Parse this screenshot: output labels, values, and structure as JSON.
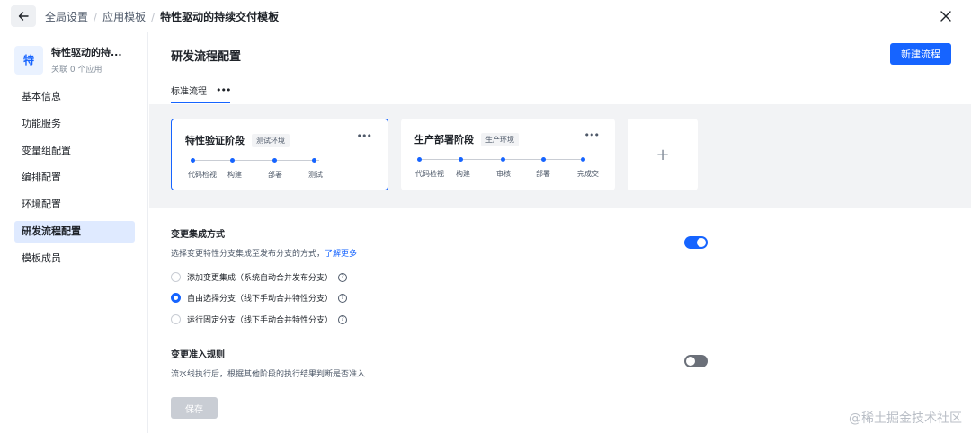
{
  "breadcrumb": [
    "全局设置",
    "应用模板"
  ],
  "breadcrumb_current": "特性驱动的持续交付模板",
  "template": {
    "avatar": "特",
    "name": "特性驱动的持...",
    "sub": "关联 0 个应用"
  },
  "nav": {
    "items": [
      "基本信息",
      "功能服务",
      "变量组配置",
      "编排配置",
      "环境配置",
      "研发流程配置",
      "模板成员"
    ],
    "active": "研发流程配置"
  },
  "main": {
    "title": "研发流程配置",
    "new_button": "新建流程",
    "tab": "标准流程",
    "more": "•••"
  },
  "stages": [
    {
      "name": "特性验证阶段",
      "env": "测试环境",
      "steps": [
        "代码检视",
        "构建",
        "部署",
        "测试"
      ]
    },
    {
      "name": "生产部署阶段",
      "env": "生产环境",
      "steps": [
        "代码检视",
        "构建",
        "审核",
        "部署",
        "完成交"
      ]
    }
  ],
  "add_stage": "+",
  "change_integration": {
    "title": "变更集成方式",
    "desc": "选择变更特性分支集成至发布分支的方式，",
    "link": "了解更多",
    "enabled": true,
    "options": [
      "添加变更集成（系统自动合并发布分支）",
      "自由选择分支（线下手动合并特性分支）",
      "运行固定分支（线下手动合并特性分支）"
    ],
    "selected_index": 1
  },
  "change_admission": {
    "title": "变更准入规则",
    "desc": "流水线执行后，根据其他阶段的执行结果判断是否准入",
    "enabled": false
  },
  "save_button": "保存",
  "watermark": "@稀土掘金技术社区",
  "colors": {
    "accent": "#1664ff",
    "nav_active": "#dfeaff",
    "stage_bg": "#f2f3f5"
  }
}
